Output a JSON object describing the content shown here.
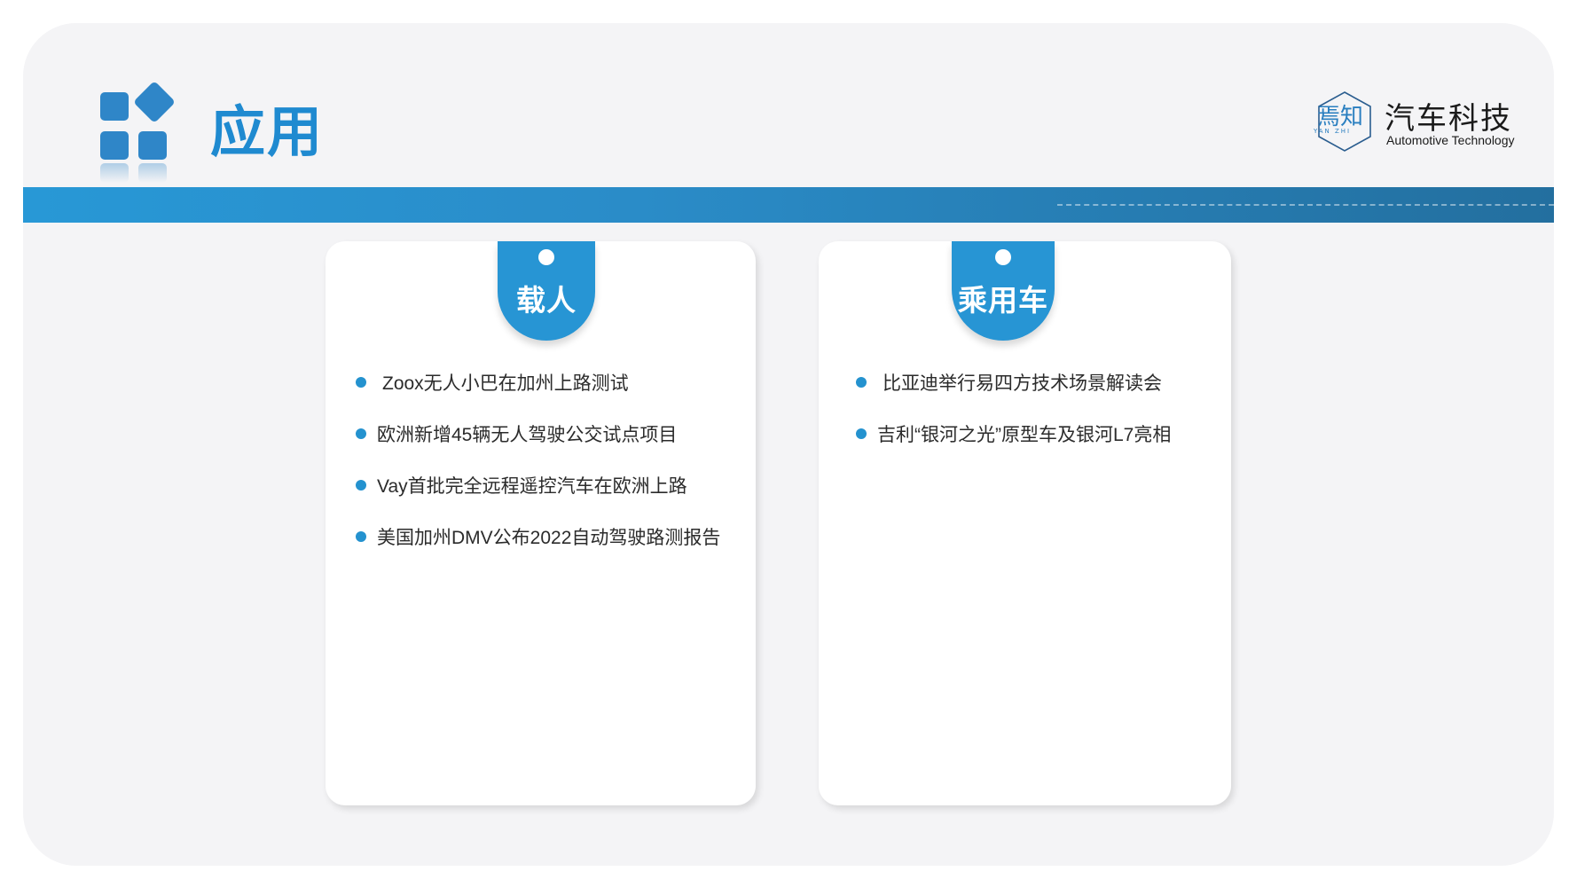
{
  "header": {
    "title": "应用",
    "icon": "four-squares-icon"
  },
  "logo": {
    "mark_text": "焉知",
    "mark_sub": "YAN ZHI",
    "name_cn": "汽车科技",
    "name_en": "Automotive Technology"
  },
  "colors": {
    "accent": "#1f8ad0",
    "band_start": "#2898d6",
    "band_end": "#236f9f",
    "card_bg": "#ffffff",
    "slide_bg": "#f4f4f6"
  },
  "cards": [
    {
      "label": "载人",
      "items": [
        "Zoox无人小巴在加州上路测试",
        "欧洲新增45辆无人驾驶公交试点项目",
        "Vay首批完全远程遥控汽车在欧洲上路",
        "美国加州DMV公布2022自动驾驶路测报告"
      ]
    },
    {
      "label": "乘用车",
      "items": [
        "比亚迪举行易四方技术场景解读会",
        "吉利“银河之光”原型车及银河L7亮相"
      ]
    }
  ]
}
